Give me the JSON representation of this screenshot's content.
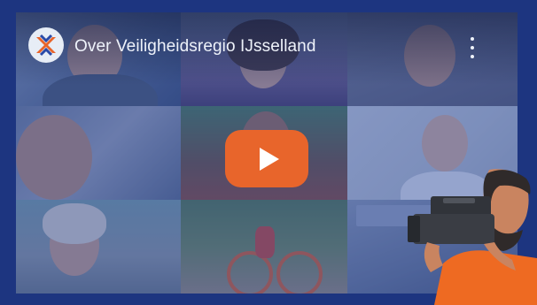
{
  "video": {
    "title": "Over Veiligheidsregio IJsselland",
    "channel_logo": "veiligheidsregio-logo-icon",
    "menu_icon": "more-vertical-icon",
    "play_icon": "play-icon"
  },
  "colors": {
    "frame": "#1d3580",
    "overlay": "#2846a0",
    "play_button": "#e8652b",
    "title_text": "#eef2fa"
  },
  "decoration": {
    "illustration": "camera-operator-icon"
  }
}
